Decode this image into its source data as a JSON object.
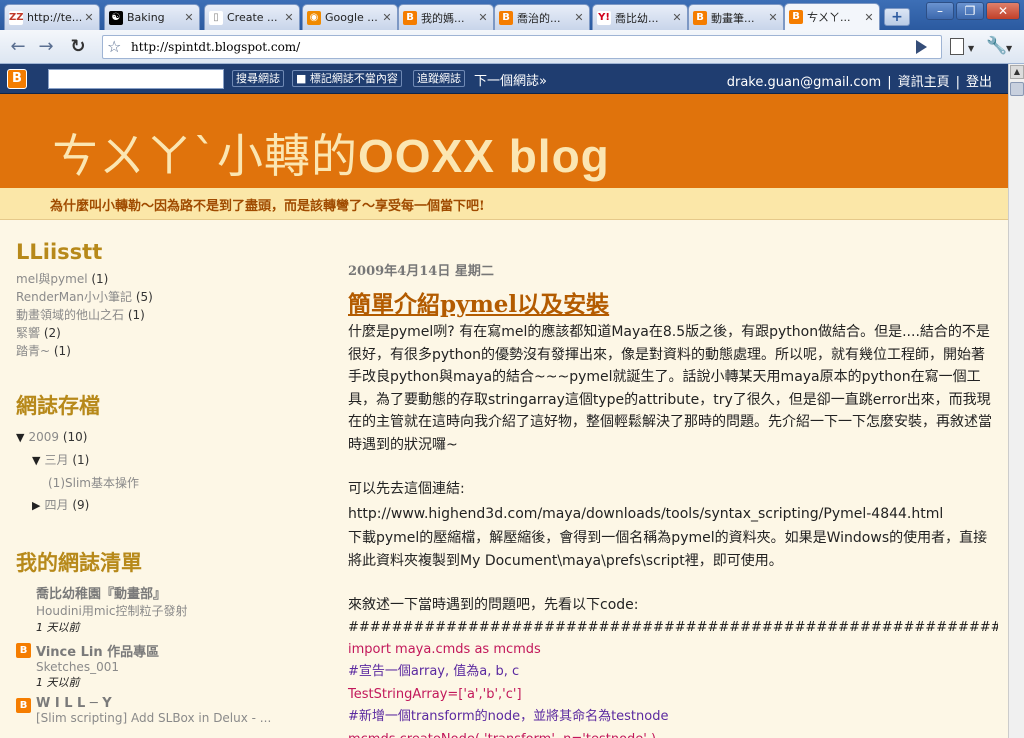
{
  "browser": {
    "tabs": [
      {
        "title": "http://te...",
        "fav": "zz-icon",
        "favcolor": "#ffffff",
        "fg": "#c0392b",
        "glyph": "ZZ"
      },
      {
        "title": "Baking",
        "fav": "yin-yang-icon",
        "favcolor": "#000000",
        "fg": "#ffffff",
        "glyph": "☯"
      },
      {
        "title": "Create ...",
        "fav": "page-icon",
        "favcolor": "#ffffff",
        "fg": "#888888",
        "glyph": "▯"
      },
      {
        "title": "Google ...",
        "fav": "rss-icon",
        "favcolor": "#f08a00",
        "fg": "#ffffff",
        "glyph": "◉"
      },
      {
        "title": "我的媽...",
        "fav": "blogger-icon",
        "favcolor": "#f57d00",
        "fg": "#ffffff",
        "glyph": "B"
      },
      {
        "title": "喬治的...",
        "fav": "blogger-icon",
        "favcolor": "#f57d00",
        "fg": "#ffffff",
        "glyph": "B"
      },
      {
        "title": "喬比幼...",
        "fav": "yahoo-icon",
        "favcolor": "#ffffff",
        "fg": "#d0021b",
        "glyph": "Y!"
      },
      {
        "title": "動畫筆...",
        "fav": "blogger-icon",
        "favcolor": "#f57d00",
        "fg": "#ffffff",
        "glyph": "B"
      },
      {
        "title": "ㄘㄨㄚ...",
        "fav": "blogger-icon",
        "favcolor": "#f57d00",
        "fg": "#ffffff",
        "glyph": "B"
      }
    ],
    "new_tab": "+",
    "minimize": "–",
    "maximize": "❐",
    "close": "✕",
    "back": "←",
    "forward": "→",
    "reload": "↻",
    "star": "☆",
    "url": "http://spintdt.blogspot.com/",
    "wrench": "🔧",
    "caret": "▼"
  },
  "navbar": {
    "logo": "B",
    "search_value": "",
    "search_blog": "搜尋網誌",
    "flag_blog": "■ 標記網誌不當內容",
    "follow_blog": "追蹤網誌",
    "next_blog": "下一個網誌»",
    "email": "drake.guan@gmail.com",
    "dashboard": "資訊主頁",
    "logout": "登出",
    "separator": "|"
  },
  "header": {
    "title_prefix": "ㄘㄨㄚˋ小轉的",
    "title_suffix": "OOXX blog",
    "tagline": "為什麼叫小轉勒～因為路不是到了盡頭，而是該轉彎了～享受每一個當下吧!"
  },
  "sidebar": {
    "labels_title": "LLiisstt",
    "labels": [
      {
        "name": "mel與pymel",
        "count": "(1)"
      },
      {
        "name": "RenderMan小小筆記",
        "count": "(5)"
      },
      {
        "name": "動畫領域的他山之石",
        "count": "(1)"
      },
      {
        "name": "緊響",
        "count": "(2)"
      },
      {
        "name": "踏青~",
        "count": "(1)"
      }
    ],
    "archive_title": "網誌存檔",
    "archive": {
      "year": "2009",
      "year_count": "(10)",
      "month1": "三月",
      "month1_count": "(1)",
      "post": "(1)Slim基本操作",
      "month2": "四月",
      "month2_count": "(9)",
      "open": "▼",
      "closed": "▶"
    },
    "bloglist_title": "我的網誌清單",
    "bloglist": [
      {
        "name": "喬比幼稚園『動畫部』",
        "post": "Houdini用mic控制粒子發射",
        "time": "1 天以前",
        "icon": false
      },
      {
        "name": "Vince Lin 作品專區",
        "post": "Sketches_001",
        "time": "1 天以前",
        "icon": true
      },
      {
        "name": "W I L L ─ Y",
        "post": "[Slim scripting] Add SLBox in Delux - ...",
        "time": "",
        "icon": true
      }
    ]
  },
  "post": {
    "date": "2009年4月14日 星期二",
    "title": "簡單介紹pymel以及安裝",
    "p1": "什麼是pymel咧? 有在寫mel的應該都知道Maya在8.5版之後，有跟python做結合。但是....結合的不是很好，有很多python的優勢沒有發揮出來，像是對資料的動態處理。所以呢，就有幾位工程師，開始著手改良python與maya的結合~~~pymel就誕生了。話說小轉某天用maya原本的python在寫一個工具，為了要動態的存取stringarray這個type的attribute，try了很久，但是卻一直跳error出來，而我現在的主管就在這時向我介紹了這好物，整個輕鬆解決了那時的問題。先介紹一下一下怎麼安裝，再敘述當時遇到的狀況囉~",
    "p2": "可以先去這個連結:",
    "link": "http://www.highend3d.com/maya/downloads/tools/syntax_scripting/Pymel-4844.html",
    "p3": "下載pymel的壓縮檔，解壓縮後，會得到一個名稱為pymel的資料夾。如果是Windows的使用者，直接將此資料夾複製到My Document\\maya\\prefs\\script裡，即可使用。",
    "p4": "來敘述一下當時遇到的問題吧，先看以下code:",
    "hashes": "##############################################################################",
    "code": [
      {
        "text": "import maya.cmds as mcmds",
        "cls": "red"
      },
      {
        "text": "#宣告一個array, 值為a, b, c",
        "cls": "purple"
      },
      {
        "text": "TestStringArray=['a','b','c']",
        "cls": "red"
      },
      {
        "text": "#新增一個transform的node，並將其命名為testnode",
        "cls": "purple"
      },
      {
        "text": "mcmds.createNode( 'transform', n='testnode' )",
        "cls": "red"
      }
    ]
  },
  "scroll": {
    "up": "▲"
  }
}
